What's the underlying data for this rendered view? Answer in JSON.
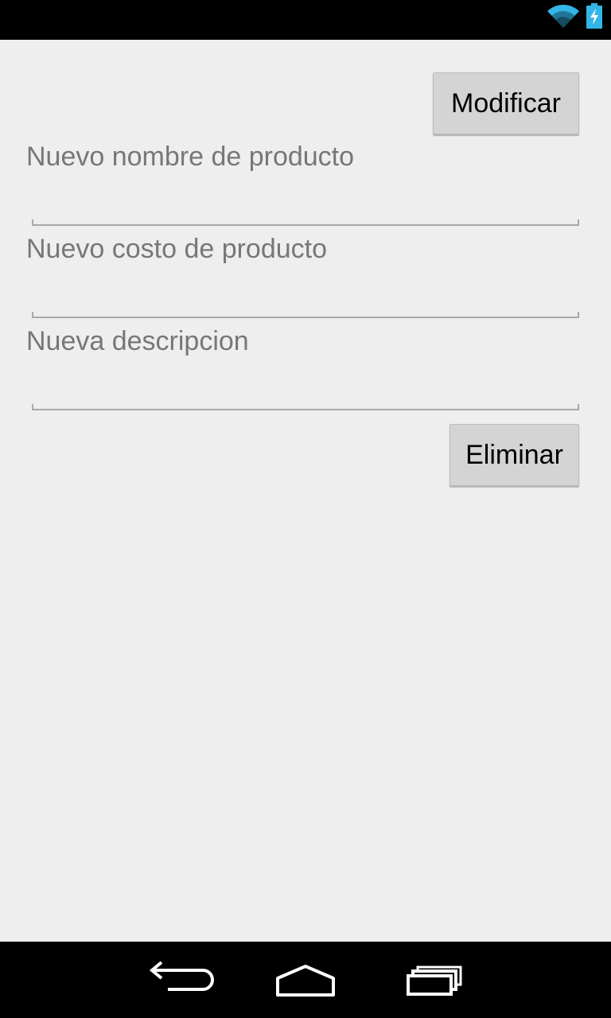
{
  "status_bar": {
    "icons": [
      "wifi-icon",
      "battery-charging-icon"
    ],
    "icon_color": "#33b5e5"
  },
  "form": {
    "modify_button_label": "Modificar",
    "name_label": "Nuevo nombre de producto",
    "name_value": "",
    "cost_label": "Nuevo costo de producto",
    "cost_value": "",
    "description_label": "Nueva descripcion",
    "description_value": "",
    "delete_button_label": "Eliminar"
  },
  "nav_bar": {
    "icons": [
      "back-icon",
      "home-icon",
      "recents-icon"
    ],
    "icon_color": "#ffffff"
  }
}
